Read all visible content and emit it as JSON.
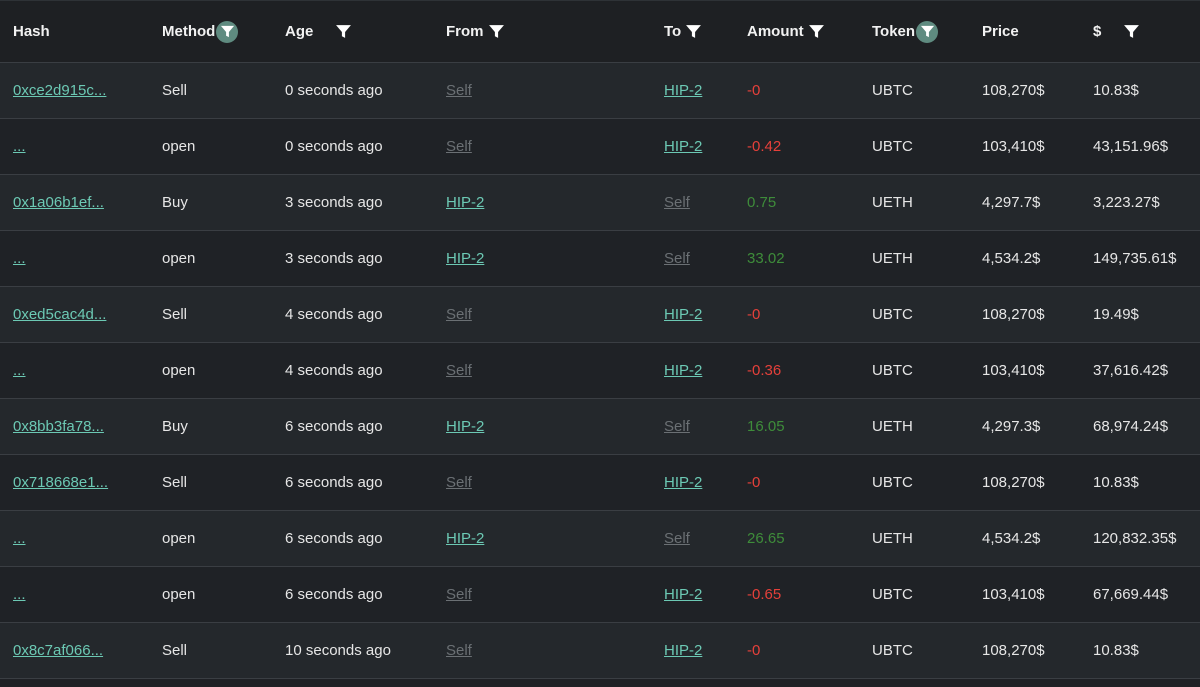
{
  "columns": {
    "hash": "Hash",
    "method": "Method",
    "age": "Age",
    "from": "From",
    "to": "To",
    "amount": "Amount",
    "token": "Token",
    "price": "Price",
    "usd": "$"
  },
  "rows": [
    {
      "hash": "0xce2d915c...",
      "method": "Sell",
      "age": "0 seconds ago",
      "from": "Self",
      "to": "HIP-2",
      "amount": "-0",
      "token": "UBTC",
      "price": "108,270$",
      "usd": "10.83$"
    },
    {
      "hash": "...",
      "method": "open",
      "age": "0 seconds ago",
      "from": "Self",
      "to": "HIP-2",
      "amount": "-0.42",
      "token": "UBTC",
      "price": "103,410$",
      "usd": "43,151.96$"
    },
    {
      "hash": "0x1a06b1ef...",
      "method": "Buy",
      "age": "3 seconds ago",
      "from": "HIP-2",
      "to": "Self",
      "amount": "0.75",
      "token": "UETH",
      "price": "4,297.7$",
      "usd": "3,223.27$"
    },
    {
      "hash": "...",
      "method": "open",
      "age": "3 seconds ago",
      "from": "HIP-2",
      "to": "Self",
      "amount": "33.02",
      "token": "UETH",
      "price": "4,534.2$",
      "usd": "149,735.61$"
    },
    {
      "hash": "0xed5cac4d...",
      "method": "Sell",
      "age": "4 seconds ago",
      "from": "Self",
      "to": "HIP-2",
      "amount": "-0",
      "token": "UBTC",
      "price": "108,270$",
      "usd": "19.49$"
    },
    {
      "hash": "...",
      "method": "open",
      "age": "4 seconds ago",
      "from": "Self",
      "to": "HIP-2",
      "amount": "-0.36",
      "token": "UBTC",
      "price": "103,410$",
      "usd": "37,616.42$"
    },
    {
      "hash": "0x8bb3fa78...",
      "method": "Buy",
      "age": "6 seconds ago",
      "from": "HIP-2",
      "to": "Self",
      "amount": "16.05",
      "token": "UETH",
      "price": "4,297.3$",
      "usd": "68,974.24$"
    },
    {
      "hash": "0x718668e1...",
      "method": "Sell",
      "age": "6 seconds ago",
      "from": "Self",
      "to": "HIP-2",
      "amount": "-0",
      "token": "UBTC",
      "price": "108,270$",
      "usd": "10.83$"
    },
    {
      "hash": "...",
      "method": "open",
      "age": "6 seconds ago",
      "from": "HIP-2",
      "to": "Self",
      "amount": "26.65",
      "token": "UETH",
      "price": "4,534.2$",
      "usd": "120,832.35$"
    },
    {
      "hash": "...",
      "method": "open",
      "age": "6 seconds ago",
      "from": "Self",
      "to": "HIP-2",
      "amount": "-0.65",
      "token": "UBTC",
      "price": "103,410$",
      "usd": "67,669.44$"
    },
    {
      "hash": "0x8c7af066...",
      "method": "Sell",
      "age": "10 seconds ago",
      "from": "Self",
      "to": "HIP-2",
      "amount": "-0",
      "token": "UBTC",
      "price": "108,270$",
      "usd": "10.83$"
    }
  ],
  "icons": {
    "filter": "filter-icon",
    "filter_active": "filter-active-icon"
  },
  "colors": {
    "link": "#6cc9b4",
    "self": "#6b7074",
    "negative": "#e5403a",
    "positive": "#3e8c3a",
    "active_filter_bg": "#5f8b80"
  }
}
